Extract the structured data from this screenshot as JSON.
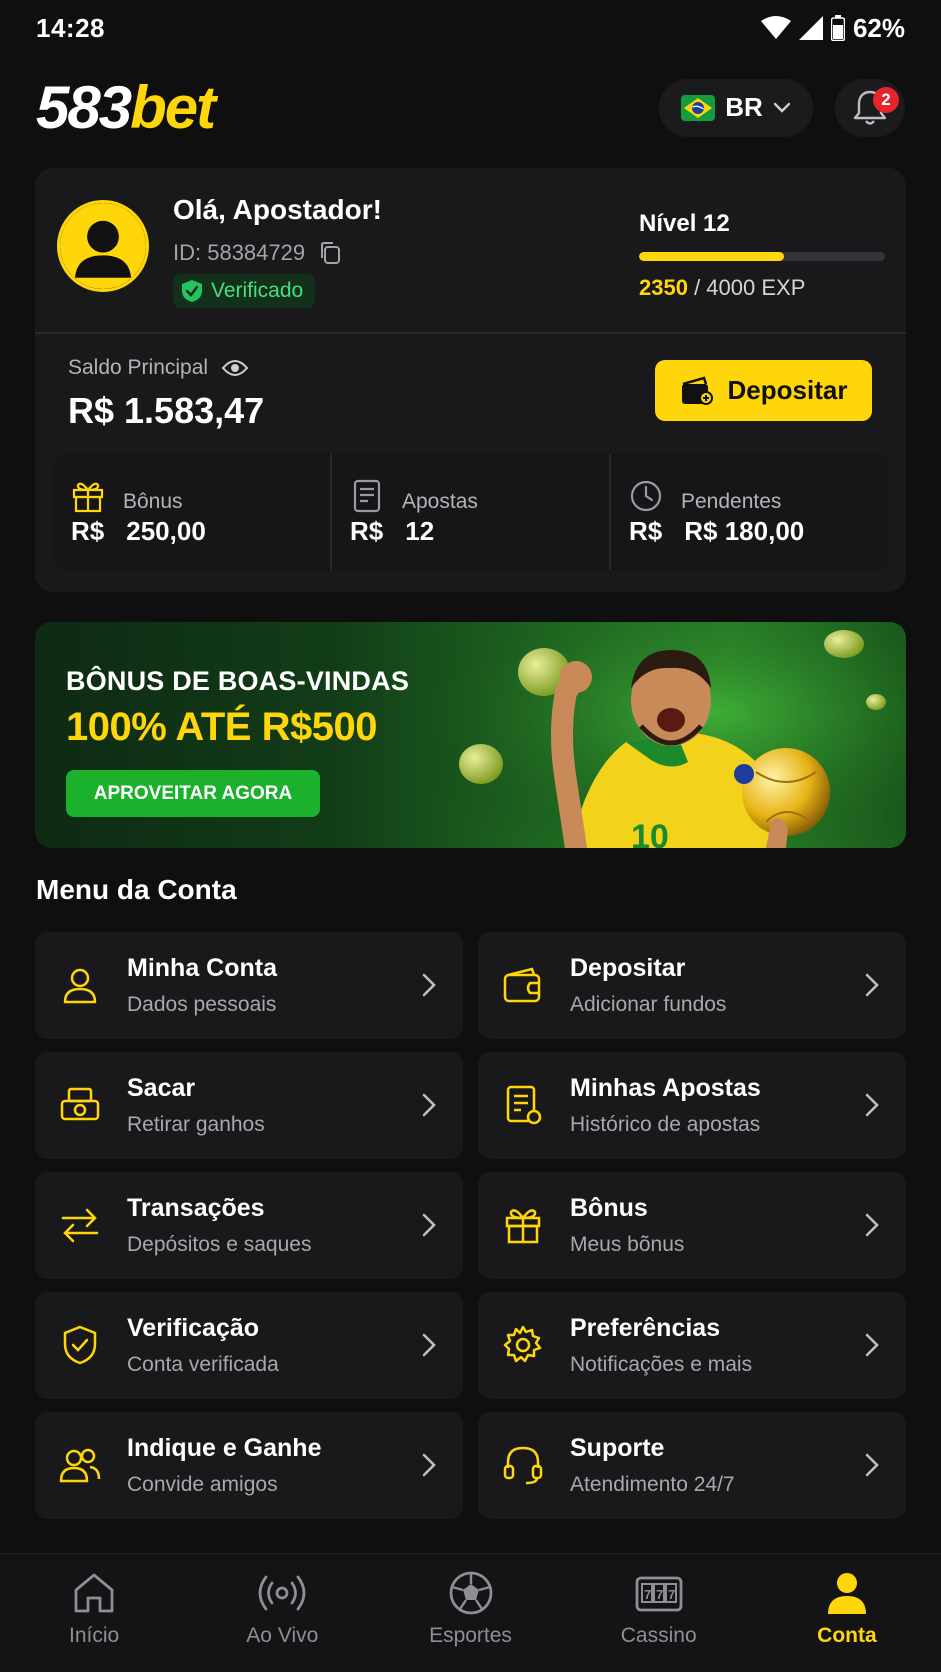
{
  "status_bar": {
    "time": "14:28",
    "battery": "62%"
  },
  "header": {
    "logo_number": "583",
    "logo_word": "bet",
    "language": "BR",
    "notifications_count": "2"
  },
  "profile": {
    "greeting": "Olá, Apostador!",
    "user_id": "ID: 58384729",
    "verified": "Verificado",
    "level": "Nível 12",
    "exp_current": "2350",
    "exp_total": " / 4000 EXP",
    "level_progress": 0.5875
  },
  "balance": {
    "label": "Saldo Principal",
    "value": "R$ 1.583,47",
    "deposit_label": "Depositar"
  },
  "stats": [
    {
      "label": "Bônus",
      "prefix": "R$",
      "value": "250,00",
      "icon": "gift-icon"
    },
    {
      "label": "Apostas",
      "prefix": "R$",
      "value": "12",
      "icon": "receipt-icon"
    },
    {
      "label": "Pendentes",
      "prefix": "R$",
      "value": "R$ 180,00",
      "icon": "clock-icon"
    }
  ],
  "promo": {
    "title": "BÔNUS DE BOAS-VINDAS",
    "subtitle": "100% ATÉ R$500",
    "cta": "APROVEITAR AGORA",
    "jersey_number": "10"
  },
  "menu": {
    "title": "Menu da Conta",
    "items": [
      {
        "label": "Minha Conta",
        "desc": "Dados pessoais",
        "icon": "user-icon"
      },
      {
        "label": "Depositar",
        "desc": "Adicionar fundos",
        "icon": "wallet-icon"
      },
      {
        "label": "Sacar",
        "desc": "Retirar ganhos",
        "icon": "withdraw-icon"
      },
      {
        "label": "Minhas Apostas",
        "desc": "Histórico de apostas",
        "icon": "bets-history-icon"
      },
      {
        "label": "Transações",
        "desc": "Depósitos e saques",
        "icon": "transfer-arrows-icon"
      },
      {
        "label": "Bônus",
        "desc": "Meus bõnus",
        "icon": "gift-icon"
      },
      {
        "label": "Verificação",
        "desc": "Conta verificada",
        "icon": "shield-check-icon"
      },
      {
        "label": "Preferências",
        "desc": "Notificações e mais",
        "icon": "gear-icon"
      },
      {
        "label": "Indique e Ganhe",
        "desc": "Convide amigos",
        "icon": "users-icon"
      },
      {
        "label": "Suporte",
        "desc": "Atendimento 24/7",
        "icon": "headset-icon"
      }
    ]
  },
  "bottom_nav": [
    {
      "label": "Início",
      "icon": "home-icon"
    },
    {
      "label": "Ao Vivo",
      "icon": "live-broadcast-icon"
    },
    {
      "label": "Esportes",
      "icon": "soccer-ball-icon"
    },
    {
      "label": "Cassino",
      "icon": "slot-machine-icon"
    },
    {
      "label": "Conta",
      "icon": "user-icon",
      "active": true
    }
  ],
  "colors": {
    "accent": "#ffd60a",
    "background": "#0f0f10",
    "card": "#19191b",
    "success": "#1bb12d",
    "badge": "#e5252c"
  }
}
